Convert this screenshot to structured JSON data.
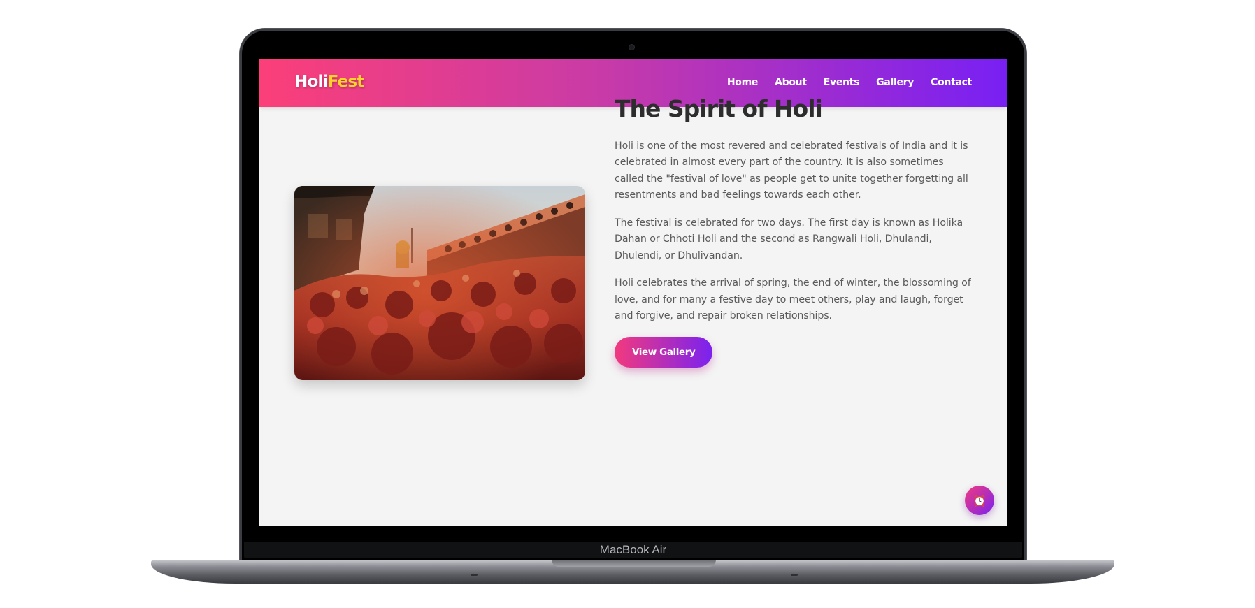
{
  "device": {
    "label": "MacBook Air"
  },
  "navbar": {
    "logo_part1": "Holi",
    "logo_part2": "Fest",
    "links": [
      "Home",
      "About",
      "Events",
      "Gallery",
      "Contact"
    ]
  },
  "hero": {
    "title": "The Spirit of Holi",
    "paragraphs": [
      "Holi is one of the most revered and celebrated festivals of India and it is celebrated in almost every part of the country. It is also sometimes called the \"festival of love\" as people get to unite together forgetting all resentments and bad feelings towards each other.",
      "The festival is celebrated for two days. The first day is known as Holika Dahan or Chhoti Holi and the second as Rangwali Holi, Dhulandi, Dhulendi, or Dhulivandan.",
      "Holi celebrates the arrival of spring, the end of winter, the blossoming of love, and for many a festive day to meet others, play and laugh, forget and forgive, and repair broken relationships."
    ],
    "button_label": "View Gallery",
    "image_icon": "holi-crowd-photo"
  },
  "fab": {
    "icon": "alarm-clock-icon"
  },
  "colors": {
    "brand_pink": "#fb3f79",
    "brand_purple": "#7820f4",
    "logo_accent": "#ffd32a"
  }
}
